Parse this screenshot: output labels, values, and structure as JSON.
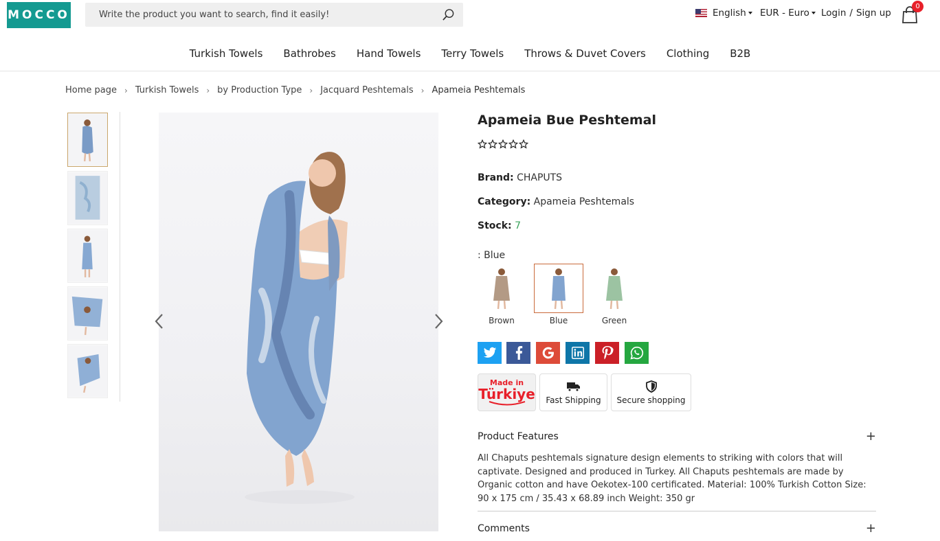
{
  "header": {
    "logo": "MOCCO",
    "search_placeholder": "Write the product you want to search, find it easily!",
    "language": "English",
    "currency": "EUR - Euro",
    "login": "Login",
    "auth_sep": "/",
    "signup": "Sign up",
    "cart_count": "0"
  },
  "nav": [
    "Turkish Towels",
    "Bathrobes",
    "Hand Towels",
    "Terry Towels",
    "Throws & Duvet Covers",
    "Clothing",
    "B2B"
  ],
  "breadcrumb": [
    "Home page",
    "Turkish Towels",
    "by Production Type",
    "Jacquard Peshtemals",
    "Apameia Peshtemals"
  ],
  "product": {
    "title": "Apameia Bue Peshtemal",
    "rating_stars": 0,
    "rating_max": 5,
    "brand_label": "Brand:",
    "brand": "CHAPUTS",
    "category_label": "Category:",
    "category": "Apameia Peshtemals",
    "stock_label": "Stock:",
    "stock": "7",
    "color_label": ": Blue",
    "colors": [
      "Brown",
      "Blue",
      "Green"
    ],
    "selected_color": "Blue"
  },
  "share": [
    "twitter",
    "facebook",
    "google",
    "linkedin",
    "pinterest",
    "whatsapp"
  ],
  "badges": {
    "made_in_top": "Made in",
    "made_in_bottom": "Türkiye",
    "fast_shipping": "Fast Shipping",
    "secure_shopping": "Secure shopping"
  },
  "sections": {
    "features_title": "Product Features",
    "features_text": "All Chaputs peshtemals signature design elements to striking with colors that will captivate. Designed and produced in Turkey. All Chaputs peshtemals are made by Organic cotton and have Oekotex-100 certificated. Material: 100% Turkish Cotton Size: 90 x 175 cm / 35.43 x 68.89 inch Weight: 350 gr",
    "comments_title": "Comments",
    "toggle": "+"
  },
  "colors": {
    "brand": "#149a91",
    "badge": "#e8202a",
    "stock": "#3aa35b",
    "twitter": "#1da1f2",
    "facebook": "#3b5998",
    "google": "#dd4b39",
    "linkedin": "#0e76a8",
    "pinterest": "#cb2027",
    "whatsapp": "#25a740"
  }
}
